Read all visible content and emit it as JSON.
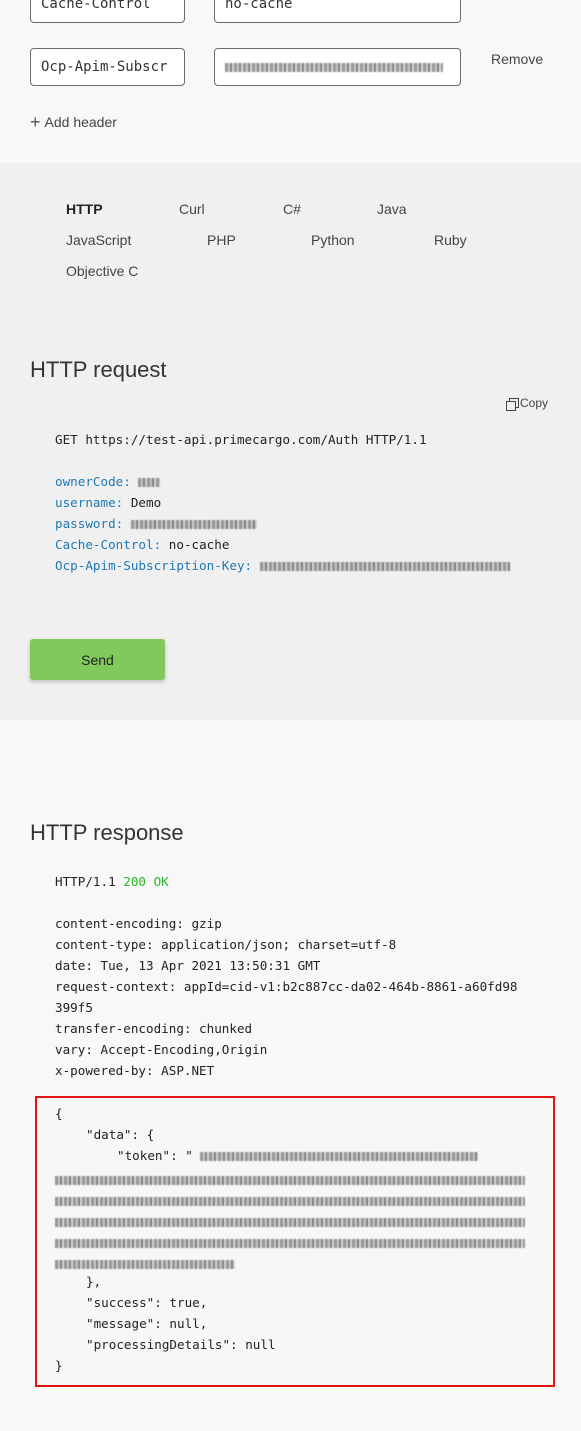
{
  "headers": {
    "rows": [
      {
        "name": "Cache-Control",
        "value": "no-cache"
      },
      {
        "name": "Ocp-Apim-Subscr",
        "value": "████████████"
      }
    ],
    "remove_label": "Remove",
    "add_label": "Add header"
  },
  "languages": [
    "HTTP",
    "Curl",
    "C#",
    "Java",
    "JavaScript",
    "PHP",
    "Python",
    "Ruby",
    "Objective C"
  ],
  "request": {
    "title": "HTTP request",
    "copy_label": "Copy",
    "request_line": "GET https://test-api.primecargo.com/Auth HTTP/1.1",
    "fields": [
      {
        "key": "ownerCode:",
        "value": ""
      },
      {
        "key": "username:",
        "value": "Demo"
      },
      {
        "key": "password:",
        "value": ""
      },
      {
        "key": "Cache-Control:",
        "value": "no-cache"
      },
      {
        "key": "Ocp-Apim-Subscription-Key:",
        "value": ""
      }
    ],
    "send_label": "Send"
  },
  "response": {
    "title": "HTTP response",
    "status_protocol": "HTTP/1.1",
    "status_code": "200 OK",
    "headers": [
      "content-encoding: gzip",
      "content-type: application/json; charset=utf-8",
      "date: Tue, 13 Apr 2021 13:50:31 GMT",
      "request-context: appId=cid-v1:b2c887cc-da02-464b-8861-a60fd98",
      "399f5",
      "transfer-encoding: chunked",
      "vary: Accept-Encoding,Origin",
      "x-powered-by: ASP.NET"
    ],
    "body": {
      "open_brace": "{",
      "data_open": "\"data\": {",
      "token_key": "\"token\": \"",
      "data_close": "},",
      "success": "\"success\": true,",
      "message": "\"message\": null,",
      "processing": "\"processingDetails\": null",
      "close_brace": "}"
    }
  },
  "colors": {
    "send_button": "#82c95d",
    "status_ok": "#2eb52e",
    "highlight_border": "#e11313",
    "header_key": "#1f78b4"
  }
}
